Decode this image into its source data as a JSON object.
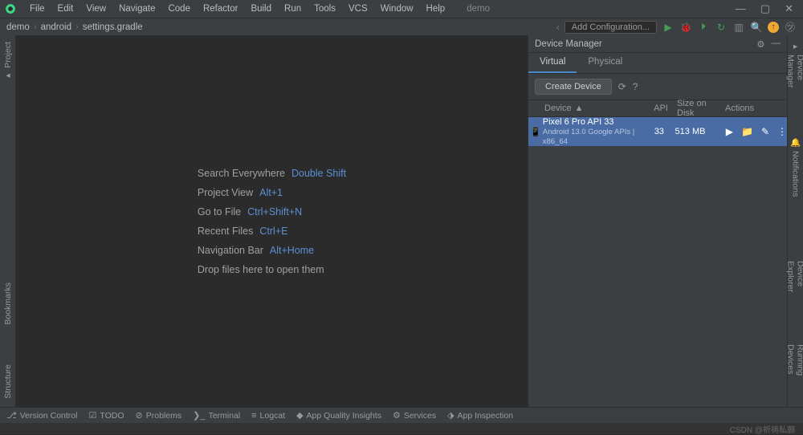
{
  "project_name": "demo",
  "menu": [
    "File",
    "Edit",
    "View",
    "Navigate",
    "Code",
    "Refactor",
    "Build",
    "Run",
    "Tools",
    "VCS",
    "Window",
    "Help"
  ],
  "breadcrumb": [
    "demo",
    "android",
    "settings.gradle"
  ],
  "add_config": "Add Configuration...",
  "left_tabs": {
    "project": "Project",
    "bookmarks": "Bookmarks",
    "structure": "Structure"
  },
  "right_tabs": {
    "device_manager": "Device Manager",
    "notifications": "Notifications",
    "device_explorer": "Device Explorer",
    "running_devices": "Running Devices"
  },
  "shortcuts": [
    {
      "label": "Search Everywhere",
      "key": "Double Shift"
    },
    {
      "label": "Project View",
      "key": "Alt+1"
    },
    {
      "label": "Go to File",
      "key": "Ctrl+Shift+N"
    },
    {
      "label": "Recent Files",
      "key": "Ctrl+E"
    },
    {
      "label": "Navigation Bar",
      "key": "Alt+Home"
    }
  ],
  "drop_hint": "Drop files here to open them",
  "device_panel": {
    "title": "Device Manager",
    "tabs": {
      "virtual": "Virtual",
      "physical": "Physical"
    },
    "create": "Create Device",
    "columns": {
      "device": "Device",
      "api": "API",
      "size": "Size on Disk",
      "actions": "Actions"
    },
    "row": {
      "name": "Pixel 6 Pro API 33",
      "sub": "Android 13.0 Google APIs | x86_64",
      "api": "33",
      "size": "513 MB"
    }
  },
  "statusbar": [
    "Version Control",
    "TODO",
    "Problems",
    "Terminal",
    "Logcat",
    "App Quality Insights",
    "Services",
    "App Inspection"
  ],
  "watermark": "CSDN @祈祷私願"
}
